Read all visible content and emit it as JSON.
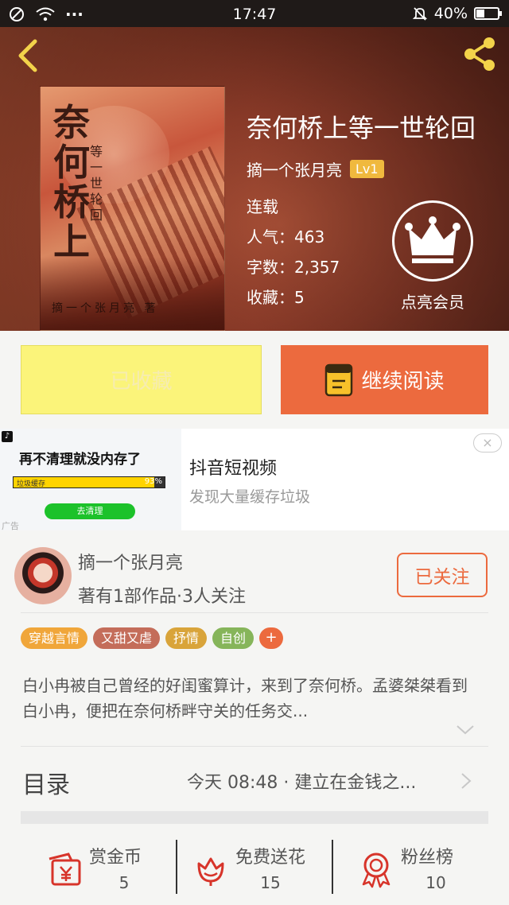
{
  "status_bar": {
    "time": "17:47",
    "battery": "40%",
    "battery_level": 0.4,
    "dots": "···"
  },
  "book": {
    "title": "奈何桥上等一世轮回",
    "author": "摘一个张月亮",
    "level": "Lv1",
    "status": "连载",
    "popularity": "人气：463",
    "word_count": "字数：2,357",
    "favorites": "收藏：5",
    "cover_title_large": "奈何桥上",
    "cover_title_small": "等一世轮回",
    "cover_author": "摘一个张月亮 著"
  },
  "vip": {
    "label": "点亮会员"
  },
  "actions": {
    "favorited_label": "已收藏",
    "continue_label": "继续阅读"
  },
  "ad": {
    "thumb_headline": "再不清理就没内存了",
    "bar_label": "垃圾缓存",
    "bar_percent": "93%",
    "bar_level": 0.93,
    "clean_button": "去清理",
    "ad_label": "广告",
    "title": "抖音短视频",
    "subtitle": "发现大量缓存垃圾",
    "close": "×"
  },
  "author_card": {
    "name": "摘一个张月亮",
    "stats": "著有1部作品·3人关注",
    "follow_label": "已关注"
  },
  "tags": [
    {
      "label": "穿越言情",
      "color": "#f0a63a"
    },
    {
      "label": "又甜又虐",
      "color": "#c46d5a"
    },
    {
      "label": "抒情",
      "color": "#d9a43a"
    },
    {
      "label": "自创",
      "color": "#86b55a"
    }
  ],
  "tag_add": "+",
  "description": "白小冉被自己曾经的好闺蜜算计，来到了奈何桥。孟婆桀桀看到白小冉，便把在奈何桥畔守关的任务交...",
  "toc": {
    "label": "目录",
    "latest": "今天 08:48 · 建立在金钱之..."
  },
  "bottom_bar": [
    {
      "label": "赏金币",
      "value": "5",
      "icon": "red-envelope-icon"
    },
    {
      "label": "免费送花",
      "value": "15",
      "icon": "flower-icon"
    },
    {
      "label": "粉丝榜",
      "value": "10",
      "icon": "medal-icon"
    }
  ],
  "colors": {
    "accent": "#ec6a3e",
    "favorited_bg": "#fbf47a",
    "icon_red": "#d7342a"
  }
}
